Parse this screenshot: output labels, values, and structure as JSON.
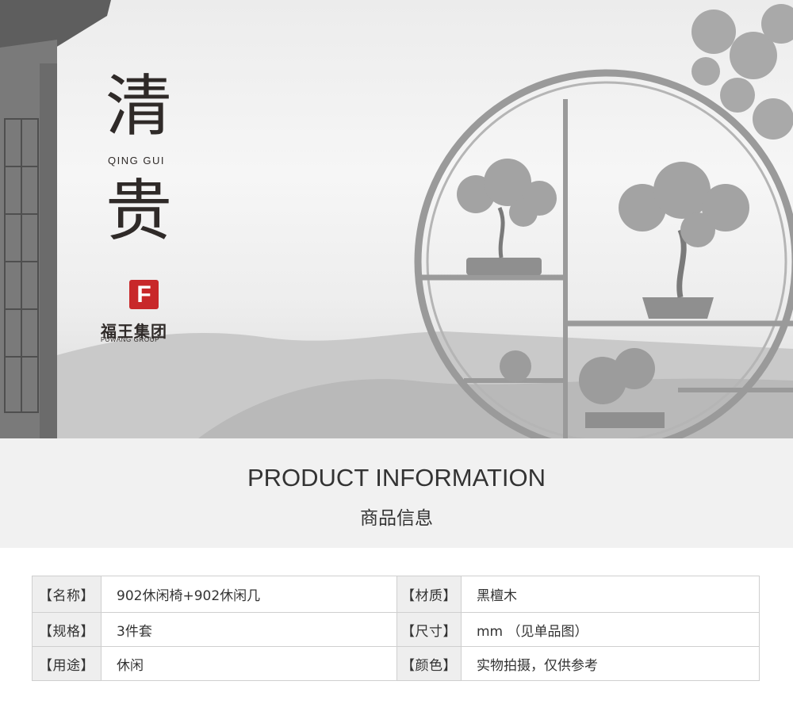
{
  "hero": {
    "title_char_1": "清",
    "title_pinyin": "QING GUI",
    "title_char_2": "贵",
    "logo_mark": "F",
    "logo_cn": "福王集团",
    "logo_en": "FUWANG GROUP"
  },
  "section": {
    "title_en": "PRODUCT INFORMATION",
    "title_cn": "商品信息"
  },
  "specs": [
    {
      "label": "【名称】",
      "value": "902休闲椅+902休闲几",
      "label2": "【材质】",
      "value2": "黑檀木"
    },
    {
      "label": "【规格】",
      "value": "3件套",
      "label2": "【尺寸】",
      "value2": "mm （见单品图）"
    },
    {
      "label": "【用途】",
      "value": "休闲",
      "label2": "【颜色】",
      "value2": "实物拍摄，仅供参考"
    }
  ],
  "colors": {
    "brand_red": "#c8282a",
    "ink": "#2f2a28",
    "band_bg": "#f1f1f1"
  }
}
